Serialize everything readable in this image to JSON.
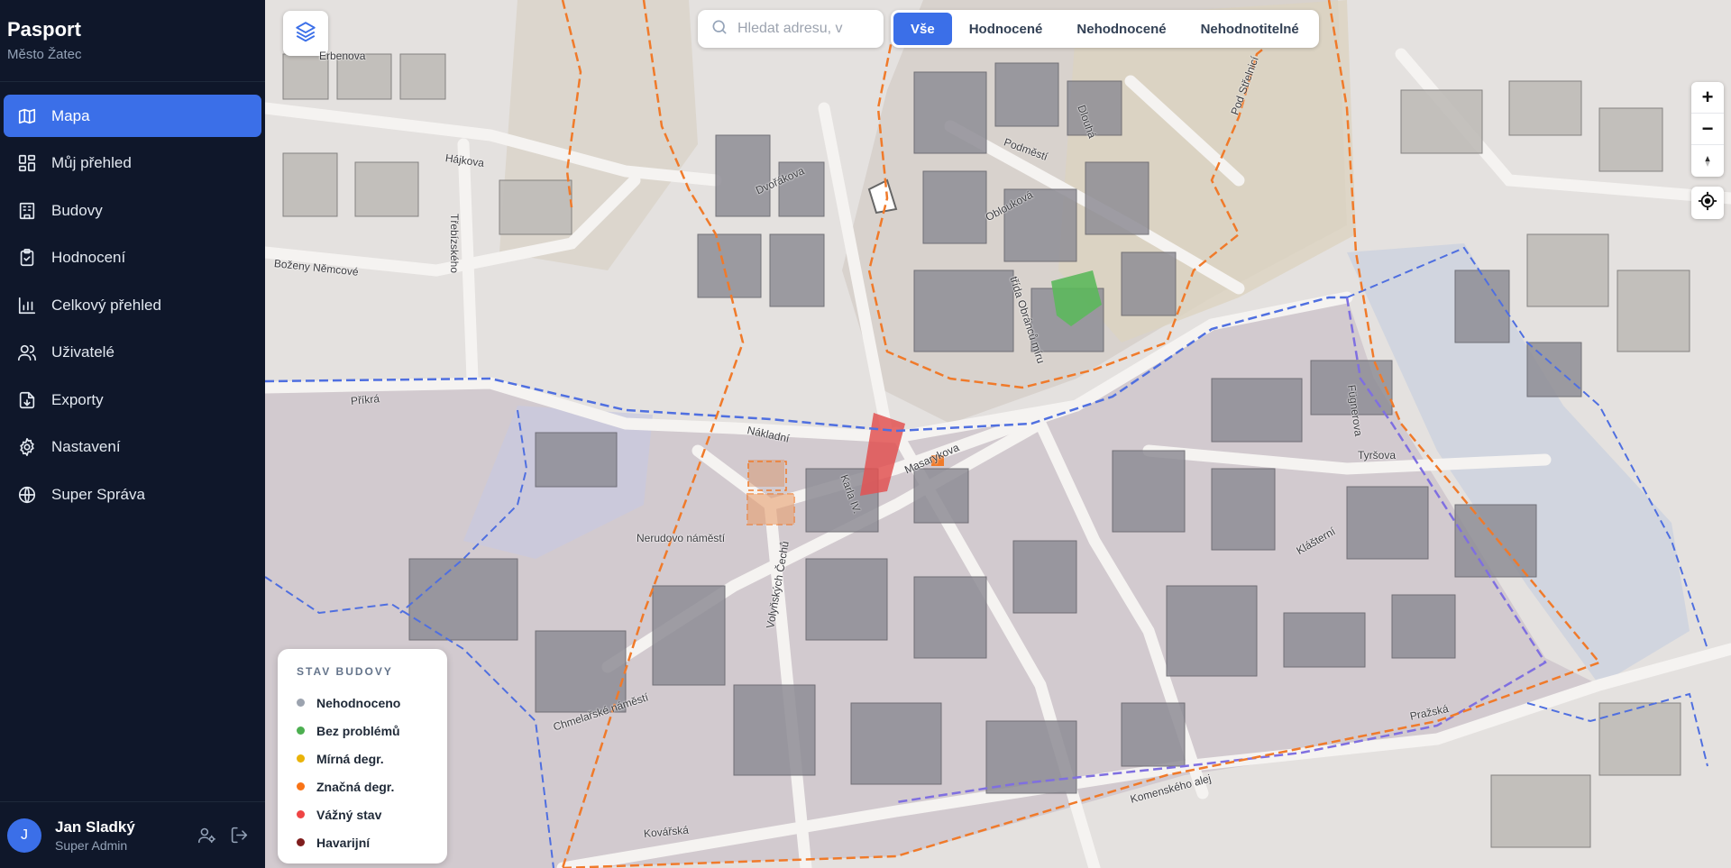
{
  "app": {
    "title": "Pasport",
    "subtitle": "Město Žatec"
  },
  "nav": [
    {
      "label": "Mapa",
      "icon": "map-icon",
      "active": true
    },
    {
      "label": "Můj přehled",
      "icon": "dashboard-grid-icon"
    },
    {
      "label": "Budovy",
      "icon": "building-icon"
    },
    {
      "label": "Hodnocení",
      "icon": "clipboard-check-icon"
    },
    {
      "label": "Celkový přehled",
      "icon": "bar-chart-icon"
    },
    {
      "label": "Uživatelé",
      "icon": "users-icon"
    },
    {
      "label": "Exporty",
      "icon": "file-download-icon"
    },
    {
      "label": "Nastavení",
      "icon": "gear-icon"
    },
    {
      "label": "Super Správa",
      "icon": "globe-icon"
    }
  ],
  "user": {
    "initial": "J",
    "name": "Jan Sladký",
    "role": "Super Admin"
  },
  "search": {
    "placeholder": "Hledat adresu, v"
  },
  "filters": [
    {
      "label": "Vše",
      "active": true
    },
    {
      "label": "Hodnocené"
    },
    {
      "label": "Nehodnocené"
    },
    {
      "label": "Nehodnotitelné"
    }
  ],
  "zoom": {
    "in_label": "+",
    "out_label": "−"
  },
  "legend": {
    "title": "STAV BUDOVY",
    "items": [
      {
        "label": "Nehodnoceno",
        "color": "#9ca3af"
      },
      {
        "label": "Bez problémů",
        "color": "#4caf50"
      },
      {
        "label": "Mírná degr.",
        "color": "#eab308"
      },
      {
        "label": "Značná degr.",
        "color": "#f97316"
      },
      {
        "label": "Vážný stav",
        "color": "#ef4444"
      },
      {
        "label": "Havarijní",
        "color": "#7f1d1d"
      }
    ]
  },
  "map": {
    "streets": [
      "Erbenova",
      "Hájkova",
      "Třebízského",
      "Boženy Němcové",
      "Příkrá",
      "Dvořákova",
      "Oblouková",
      "třída Obránců míru",
      "Nákladní",
      "Masarykova",
      "Nerudovo náměstí",
      "Karla IV.",
      "Klášterní",
      "Tyršova",
      "Komenského alej",
      "Pražská",
      "Chmelařské náměstí",
      "Kovářská",
      "Volyňských Čechů",
      "Podměstí",
      "Dlouhá",
      "Pod Střelnicí",
      "Fügnerova"
    ],
    "colors": {
      "base": "#e4e1df",
      "zone": "#cfc5cc",
      "building": "#8f8e96",
      "blue_border": "#4f6fe0",
      "orange_border": "#f07a2a"
    }
  }
}
